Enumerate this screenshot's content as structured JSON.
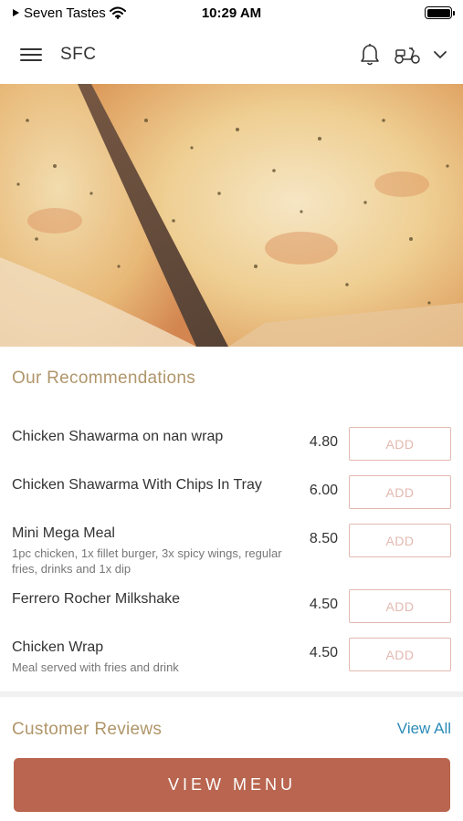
{
  "status_bar": {
    "carrier": "Seven Tastes",
    "time": "10:29 AM"
  },
  "header": {
    "title": "SFC",
    "icons": [
      "hamburger-menu-icon",
      "bell-icon",
      "scooter-icon",
      "chevron-down-icon"
    ]
  },
  "hero": {
    "image": "pizza-slices-photo"
  },
  "recommendations": {
    "title": "Our Recommendations",
    "items": [
      {
        "name": "Chicken Shawarma on nan wrap",
        "description": "",
        "price": "4.80",
        "action": "ADD"
      },
      {
        "name": "Chicken Shawarma With Chips In Tray",
        "description": "",
        "price": "6.00",
        "action": "ADD"
      },
      {
        "name": "Mini Mega Meal",
        "description": "1pc chicken, 1x fillet burger, 3x spicy wings, regular fries, drinks and 1x dip",
        "price": "8.50",
        "action": "ADD"
      },
      {
        "name": "Ferrero Rocher Milkshake",
        "description": "",
        "price": "4.50",
        "action": "ADD"
      },
      {
        "name": "Chicken Wrap",
        "description": "Meal served with fries and drink",
        "price": "4.50",
        "action": "ADD"
      }
    ]
  },
  "reviews": {
    "title": "Customer Reviews",
    "view_all": "View All"
  },
  "footer": {
    "view_menu": "VIEW MENU"
  },
  "colors": {
    "accent": "#b9654f",
    "section_title": "#b0966a",
    "link": "#2b8bb8",
    "add_button": "#e3b9b1"
  }
}
